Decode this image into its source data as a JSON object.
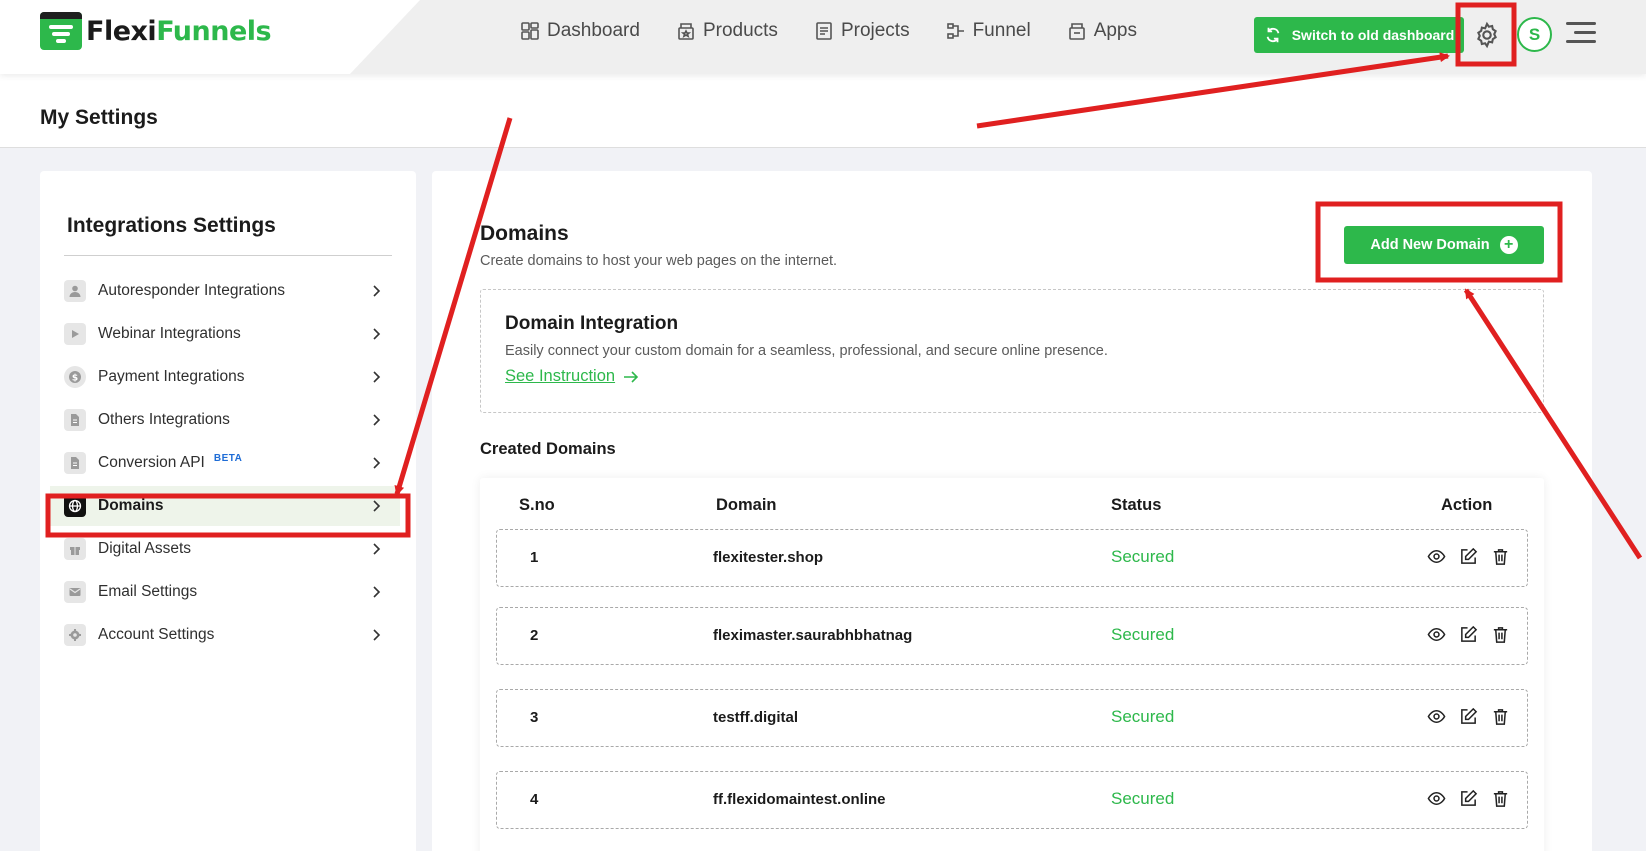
{
  "brand": {
    "logo_part1": "Flexi",
    "logo_part2": "Funnels"
  },
  "nav": [
    {
      "label": "Dashboard",
      "icon": "dashboard-icon"
    },
    {
      "label": "Products",
      "icon": "products-icon"
    },
    {
      "label": "Projects",
      "icon": "projects-icon"
    },
    {
      "label": "Funnel",
      "icon": "funnel-icon"
    },
    {
      "label": "Apps",
      "icon": "apps-icon"
    }
  ],
  "header": {
    "switch_label": "Switch to old dashboard",
    "avatar_initial": "S"
  },
  "page": {
    "title": "My Settings"
  },
  "sidebar": {
    "title": "Integrations Settings",
    "items": [
      {
        "label": "Autoresponder Integrations",
        "icon": "user-icon"
      },
      {
        "label": "Webinar Integrations",
        "icon": "play-icon"
      },
      {
        "label": "Payment Integrations",
        "icon": "dollar-icon"
      },
      {
        "label": "Others Integrations",
        "icon": "document-icon"
      },
      {
        "label": "Conversion API",
        "badge": "BETA",
        "icon": "document-icon"
      },
      {
        "label": "Domains",
        "icon": "globe-icon",
        "active": true
      },
      {
        "label": "Digital Assets",
        "icon": "gift-icon"
      },
      {
        "label": "Email Settings",
        "icon": "envelope-icon"
      },
      {
        "label": "Account Settings",
        "icon": "gear-icon"
      }
    ]
  },
  "main": {
    "title": "Domains",
    "subtitle": "Create domains to host your web pages on the internet.",
    "add_button": "Add New Domain",
    "integration": {
      "title": "Domain Integration",
      "description": "Easily connect your custom domain for a seamless, professional, and secure online presence.",
      "link": "See Instruction"
    },
    "created_title": "Created Domains",
    "table": {
      "headers": [
        "S.no",
        "Domain",
        "Status",
        "Action"
      ],
      "rows": [
        {
          "sno": "1",
          "domain": "flexitester.shop",
          "status": "Secured"
        },
        {
          "sno": "2",
          "domain": "fleximaster.saurabhbhatnag",
          "status": "Secured"
        },
        {
          "sno": "3",
          "domain": "testff.digital",
          "status": "Secured"
        },
        {
          "sno": "4",
          "domain": "ff.flexidomaintest.online",
          "status": "Secured"
        }
      ]
    }
  },
  "colors": {
    "brand_green": "#2db84b",
    "annotation_red": "#e02020",
    "beta_blue": "#1e6cd6"
  }
}
